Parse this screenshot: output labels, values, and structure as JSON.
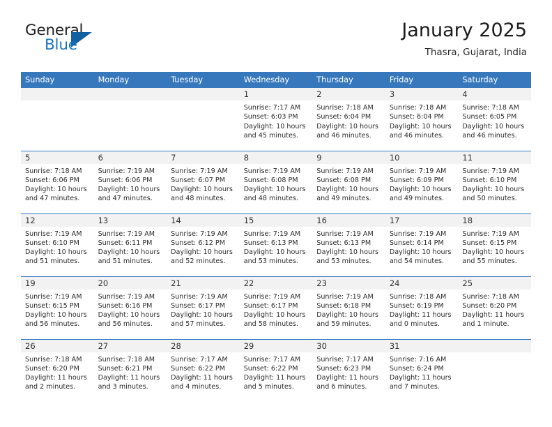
{
  "brand": {
    "line1": "General",
    "line2": "Blue",
    "logo_icon": "triangle-flag-icon",
    "accent_color": "#1b74c4",
    "dark_color": "#12609f"
  },
  "header": {
    "title": "January 2025",
    "subtitle": "Thasra, Gujarat, India"
  },
  "theme": {
    "header_row_bg": "#3778bd",
    "daynum_band_bg": "#f2f2f2",
    "row_separator": "#3778bd"
  },
  "weekday_headers": [
    "Sunday",
    "Monday",
    "Tuesday",
    "Wednesday",
    "Thursday",
    "Friday",
    "Saturday"
  ],
  "weeks": [
    [
      {
        "day": "",
        "sunrise": "",
        "sunset": "",
        "daylight_l1": "",
        "daylight_l2": ""
      },
      {
        "day": "",
        "sunrise": "",
        "sunset": "",
        "daylight_l1": "",
        "daylight_l2": ""
      },
      {
        "day": "",
        "sunrise": "",
        "sunset": "",
        "daylight_l1": "",
        "daylight_l2": ""
      },
      {
        "day": "1",
        "sunrise": "Sunrise: 7:17 AM",
        "sunset": "Sunset: 6:03 PM",
        "daylight_l1": "Daylight: 10 hours",
        "daylight_l2": "and 45 minutes."
      },
      {
        "day": "2",
        "sunrise": "Sunrise: 7:18 AM",
        "sunset": "Sunset: 6:04 PM",
        "daylight_l1": "Daylight: 10 hours",
        "daylight_l2": "and 46 minutes."
      },
      {
        "day": "3",
        "sunrise": "Sunrise: 7:18 AM",
        "sunset": "Sunset: 6:04 PM",
        "daylight_l1": "Daylight: 10 hours",
        "daylight_l2": "and 46 minutes."
      },
      {
        "day": "4",
        "sunrise": "Sunrise: 7:18 AM",
        "sunset": "Sunset: 6:05 PM",
        "daylight_l1": "Daylight: 10 hours",
        "daylight_l2": "and 46 minutes."
      }
    ],
    [
      {
        "day": "5",
        "sunrise": "Sunrise: 7:18 AM",
        "sunset": "Sunset: 6:06 PM",
        "daylight_l1": "Daylight: 10 hours",
        "daylight_l2": "and 47 minutes."
      },
      {
        "day": "6",
        "sunrise": "Sunrise: 7:19 AM",
        "sunset": "Sunset: 6:06 PM",
        "daylight_l1": "Daylight: 10 hours",
        "daylight_l2": "and 47 minutes."
      },
      {
        "day": "7",
        "sunrise": "Sunrise: 7:19 AM",
        "sunset": "Sunset: 6:07 PM",
        "daylight_l1": "Daylight: 10 hours",
        "daylight_l2": "and 48 minutes."
      },
      {
        "day": "8",
        "sunrise": "Sunrise: 7:19 AM",
        "sunset": "Sunset: 6:08 PM",
        "daylight_l1": "Daylight: 10 hours",
        "daylight_l2": "and 48 minutes."
      },
      {
        "day": "9",
        "sunrise": "Sunrise: 7:19 AM",
        "sunset": "Sunset: 6:08 PM",
        "daylight_l1": "Daylight: 10 hours",
        "daylight_l2": "and 49 minutes."
      },
      {
        "day": "10",
        "sunrise": "Sunrise: 7:19 AM",
        "sunset": "Sunset: 6:09 PM",
        "daylight_l1": "Daylight: 10 hours",
        "daylight_l2": "and 49 minutes."
      },
      {
        "day": "11",
        "sunrise": "Sunrise: 7:19 AM",
        "sunset": "Sunset: 6:10 PM",
        "daylight_l1": "Daylight: 10 hours",
        "daylight_l2": "and 50 minutes."
      }
    ],
    [
      {
        "day": "12",
        "sunrise": "Sunrise: 7:19 AM",
        "sunset": "Sunset: 6:10 PM",
        "daylight_l1": "Daylight: 10 hours",
        "daylight_l2": "and 51 minutes."
      },
      {
        "day": "13",
        "sunrise": "Sunrise: 7:19 AM",
        "sunset": "Sunset: 6:11 PM",
        "daylight_l1": "Daylight: 10 hours",
        "daylight_l2": "and 51 minutes."
      },
      {
        "day": "14",
        "sunrise": "Sunrise: 7:19 AM",
        "sunset": "Sunset: 6:12 PM",
        "daylight_l1": "Daylight: 10 hours",
        "daylight_l2": "and 52 minutes."
      },
      {
        "day": "15",
        "sunrise": "Sunrise: 7:19 AM",
        "sunset": "Sunset: 6:13 PM",
        "daylight_l1": "Daylight: 10 hours",
        "daylight_l2": "and 53 minutes."
      },
      {
        "day": "16",
        "sunrise": "Sunrise: 7:19 AM",
        "sunset": "Sunset: 6:13 PM",
        "daylight_l1": "Daylight: 10 hours",
        "daylight_l2": "and 53 minutes."
      },
      {
        "day": "17",
        "sunrise": "Sunrise: 7:19 AM",
        "sunset": "Sunset: 6:14 PM",
        "daylight_l1": "Daylight: 10 hours",
        "daylight_l2": "and 54 minutes."
      },
      {
        "day": "18",
        "sunrise": "Sunrise: 7:19 AM",
        "sunset": "Sunset: 6:15 PM",
        "daylight_l1": "Daylight: 10 hours",
        "daylight_l2": "and 55 minutes."
      }
    ],
    [
      {
        "day": "19",
        "sunrise": "Sunrise: 7:19 AM",
        "sunset": "Sunset: 6:15 PM",
        "daylight_l1": "Daylight: 10 hours",
        "daylight_l2": "and 56 minutes."
      },
      {
        "day": "20",
        "sunrise": "Sunrise: 7:19 AM",
        "sunset": "Sunset: 6:16 PM",
        "daylight_l1": "Daylight: 10 hours",
        "daylight_l2": "and 56 minutes."
      },
      {
        "day": "21",
        "sunrise": "Sunrise: 7:19 AM",
        "sunset": "Sunset: 6:17 PM",
        "daylight_l1": "Daylight: 10 hours",
        "daylight_l2": "and 57 minutes."
      },
      {
        "day": "22",
        "sunrise": "Sunrise: 7:19 AM",
        "sunset": "Sunset: 6:17 PM",
        "daylight_l1": "Daylight: 10 hours",
        "daylight_l2": "and 58 minutes."
      },
      {
        "day": "23",
        "sunrise": "Sunrise: 7:19 AM",
        "sunset": "Sunset: 6:18 PM",
        "daylight_l1": "Daylight: 10 hours",
        "daylight_l2": "and 59 minutes."
      },
      {
        "day": "24",
        "sunrise": "Sunrise: 7:18 AM",
        "sunset": "Sunset: 6:19 PM",
        "daylight_l1": "Daylight: 11 hours",
        "daylight_l2": "and 0 minutes."
      },
      {
        "day": "25",
        "sunrise": "Sunrise: 7:18 AM",
        "sunset": "Sunset: 6:20 PM",
        "daylight_l1": "Daylight: 11 hours",
        "daylight_l2": "and 1 minute."
      }
    ],
    [
      {
        "day": "26",
        "sunrise": "Sunrise: 7:18 AM",
        "sunset": "Sunset: 6:20 PM",
        "daylight_l1": "Daylight: 11 hours",
        "daylight_l2": "and 2 minutes."
      },
      {
        "day": "27",
        "sunrise": "Sunrise: 7:18 AM",
        "sunset": "Sunset: 6:21 PM",
        "daylight_l1": "Daylight: 11 hours",
        "daylight_l2": "and 3 minutes."
      },
      {
        "day": "28",
        "sunrise": "Sunrise: 7:17 AM",
        "sunset": "Sunset: 6:22 PM",
        "daylight_l1": "Daylight: 11 hours",
        "daylight_l2": "and 4 minutes."
      },
      {
        "day": "29",
        "sunrise": "Sunrise: 7:17 AM",
        "sunset": "Sunset: 6:22 PM",
        "daylight_l1": "Daylight: 11 hours",
        "daylight_l2": "and 5 minutes."
      },
      {
        "day": "30",
        "sunrise": "Sunrise: 7:17 AM",
        "sunset": "Sunset: 6:23 PM",
        "daylight_l1": "Daylight: 11 hours",
        "daylight_l2": "and 6 minutes."
      },
      {
        "day": "31",
        "sunrise": "Sunrise: 7:16 AM",
        "sunset": "Sunset: 6:24 PM",
        "daylight_l1": "Daylight: 11 hours",
        "daylight_l2": "and 7 minutes."
      },
      {
        "day": "",
        "sunrise": "",
        "sunset": "",
        "daylight_l1": "",
        "daylight_l2": ""
      }
    ]
  ]
}
